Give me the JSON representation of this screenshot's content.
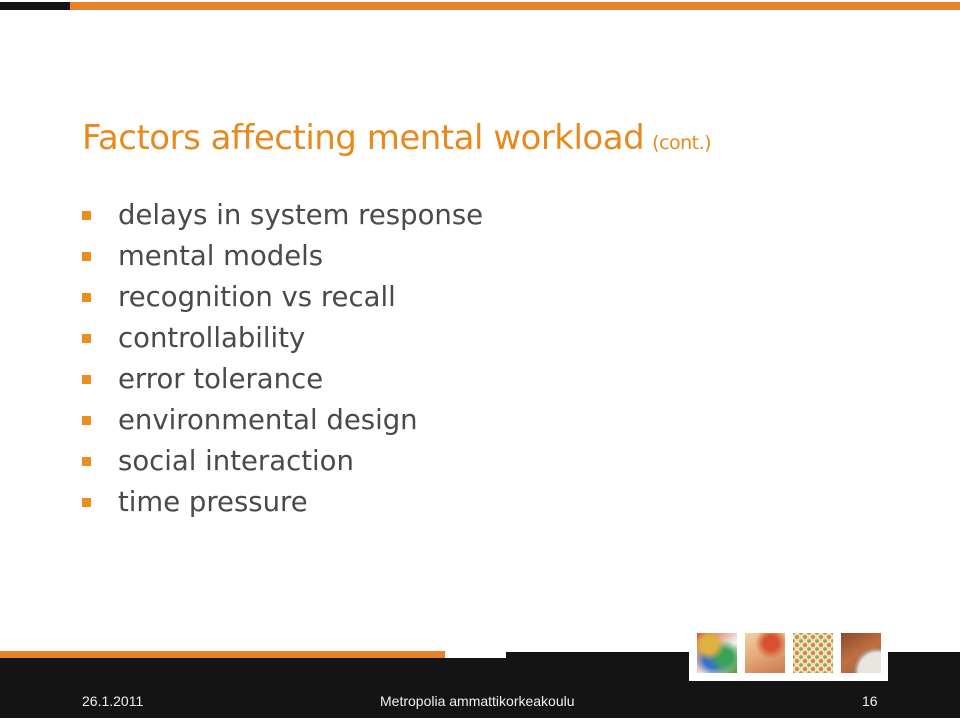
{
  "title": {
    "main": "Factors affecting mental workload",
    "suffix": "(cont.)"
  },
  "bullets": [
    "delays in system response",
    "mental models",
    "recognition vs recall",
    "controllability",
    "error tolerance",
    "environmental design",
    "social interaction",
    "time pressure"
  ],
  "footer": {
    "date": "26.1.2011",
    "organization": "Metropolia ammattikorkeakoulu",
    "page_number": "16",
    "thumbnails": [
      "abstract-paint-image",
      "red-sketch-image",
      "dotted-pattern-image",
      "brown-curve-image"
    ]
  },
  "colors": {
    "accent_orange": "#e8822a",
    "title_orange": "#e8891e",
    "body_text": "#4a4a4a",
    "bar_black": "#141414"
  }
}
